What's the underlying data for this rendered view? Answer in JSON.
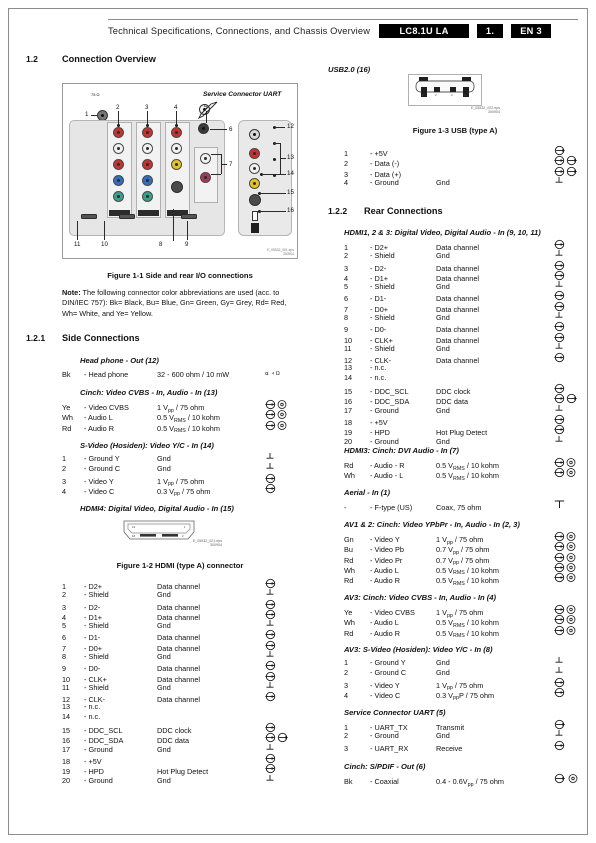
{
  "header": {
    "title": "Technical Specifications, Connections, and Chassis Overview",
    "chassis": "LC8.1U LA",
    "section": "1.",
    "language": "EN 3"
  },
  "sections": {
    "connection_overview": {
      "num": "1.2",
      "title": "Connection Overview"
    },
    "side_connections": {
      "num": "1.2.1",
      "title": "Side Connections"
    },
    "rear_connections": {
      "num": "1.2.2",
      "title": "Rear Connections"
    }
  },
  "figures": {
    "fig_1_1": "Figure 1-1 Side and rear I/O connections",
    "fig_1_2": "Figure 1-2 HDMI (type A) connector",
    "fig_1_3": "Figure 1-3  USB (type A)",
    "usb_heading": "USB2.0 (16)",
    "service_connector_label": "Service Connector UART",
    "fig_source_1": "E_05532_022.eps",
    "fig_source_2": "300904",
    "fig1_source_1": "E_05532_001.eps",
    "fig1_source_2": "300904",
    "hdmi_source_1": "E_05532_021.eps",
    "hdmi_source_2": "300904"
  },
  "note": {
    "label": "Note:",
    "text": " The following connector color abbreviations are used (acc. to DIN/IEC 757): Bk= Black, Bu= Blue, Gn= Green, Gy= Grey, Rd= Red, Wh= White, and Ye= Yellow."
  },
  "callouts": {
    "numbers": [
      "1",
      "2",
      "3",
      "4",
      "5",
      "6",
      "7",
      "8",
      "9",
      "10",
      "11",
      "12",
      "13",
      "14",
      "15",
      "16"
    ]
  },
  "groups": {
    "headphone": {
      "title": "Head phone - Out (12)",
      "rows": [
        {
          "pin": "Bk",
          "name": "- Head phone",
          "desc": "32 - 600 ohm / 10 mW",
          "sym": "headphone-ohm"
        }
      ]
    },
    "cinch_cvbs_side": {
      "title": "Cinch: Video CVBS - In, Audio - In (13)",
      "rows": [
        {
          "pin": "Ye",
          "name": "- Video CVBS",
          "desc": "1 V<sub>pp</sub> / 75 ohm",
          "sym": "in-cinch"
        },
        {
          "pin": "Wh",
          "name": "- Audio L",
          "desc": "0.5 V<sub>RMS</sub> / 10 kohm",
          "sym": "in-cinch"
        },
        {
          "pin": "Rd",
          "name": "- Audio R",
          "desc": "0.5 V<sub>RMS</sub> / 10 kohm",
          "sym": "in-cinch"
        }
      ]
    },
    "svideo_side": {
      "title": "S-Video (Hosiden): Video Y/C - In (14)",
      "rows": [
        {
          "pin": "1",
          "name": "- Ground Y",
          "desc": "Gnd",
          "sym": "gnd"
        },
        {
          "pin": "2",
          "name": "- Ground C",
          "desc": "Gnd",
          "sym": "gnd"
        },
        {
          "pin": "3",
          "name": "- Video Y",
          "desc": "1 V<sub>pp</sub> / 75 ohm",
          "sym": "in"
        },
        {
          "pin": "4",
          "name": "- Video C",
          "desc": "0.3 V<sub>pp</sub> / 75 ohm",
          "sym": "in"
        }
      ]
    },
    "hdmi4": {
      "title": "HDMI4: Digital Video, Digital Audio - In (15)",
      "rows": [
        {
          "pin": "1",
          "name": "- D2+",
          "desc": "Data channel",
          "sym": "in"
        },
        {
          "pin": "2",
          "name": "- Shield",
          "desc": "Gnd",
          "sym": "gnd"
        },
        {
          "pin": "3",
          "name": "- D2-",
          "desc": "Data channel",
          "sym": "in"
        },
        {
          "pin": "4",
          "name": "- D1+",
          "desc": "Data channel",
          "sym": "in"
        },
        {
          "pin": "5",
          "name": "- Shield",
          "desc": "Gnd",
          "sym": "gnd"
        },
        {
          "pin": "6",
          "name": "- D1-",
          "desc": "Data channel",
          "sym": "in"
        },
        {
          "pin": "7",
          "name": "- D0+",
          "desc": "Data channel",
          "sym": "in"
        },
        {
          "pin": "8",
          "name": "- Shield",
          "desc": "Gnd",
          "sym": "gnd"
        },
        {
          "pin": "9",
          "name": "- D0-",
          "desc": "Data channel",
          "sym": "in"
        },
        {
          "pin": "10",
          "name": "- CLK+",
          "desc": "Data channel",
          "sym": "in"
        },
        {
          "pin": "11",
          "name": "- Shield",
          "desc": "Gnd",
          "sym": "gnd"
        },
        {
          "pin": "12",
          "name": "- CLK-",
          "desc": "Data channel",
          "sym": "in"
        },
        {
          "pin": "13",
          "name": "- n.c.",
          "desc": "",
          "sym": ""
        },
        {
          "pin": "14",
          "name": "- n.c.",
          "desc": "",
          "sym": ""
        },
        {
          "pin": "15",
          "name": "- DDC_SCL",
          "desc": "DDC clock",
          "sym": "in"
        },
        {
          "pin": "16",
          "name": "- DDC_SDA",
          "desc": "DDC data",
          "sym": "inout"
        },
        {
          "pin": "17",
          "name": "- Ground",
          "desc": "Gnd",
          "sym": "gnd"
        },
        {
          "pin": "18",
          "name": "- +5V",
          "desc": "",
          "sym": "in"
        },
        {
          "pin": "19",
          "name": "- HPD",
          "desc": "Hot Plug Detect",
          "sym": "in"
        },
        {
          "pin": "20",
          "name": "- Ground",
          "desc": "Gnd",
          "sym": "gnd"
        }
      ]
    },
    "usb": {
      "rows": [
        {
          "pin": "1",
          "name": "- +5V",
          "desc": "",
          "sym": "out"
        },
        {
          "pin": "2",
          "name": "- Data (-)",
          "desc": "",
          "sym": "inout"
        },
        {
          "pin": "3",
          "name": "- Data (+)",
          "desc": "",
          "sym": "inout"
        },
        {
          "pin": "4",
          "name": "- Ground",
          "desc": "Gnd",
          "sym": "gnd"
        }
      ]
    },
    "hdmi123": {
      "title": "HDMI1, 2 & 3: Digital Video, Digital Audio - In (9, 10, 11)",
      "rows": [
        {
          "pin": "1",
          "name": "- D2+",
          "desc": "Data channel",
          "sym": "in"
        },
        {
          "pin": "2",
          "name": "- Shield",
          "desc": "Gnd",
          "sym": "gnd"
        },
        {
          "pin": "3",
          "name": "- D2-",
          "desc": "Data channel",
          "sym": "in"
        },
        {
          "pin": "4",
          "name": "- D1+",
          "desc": "Data channel",
          "sym": "in"
        },
        {
          "pin": "5",
          "name": "- Shield",
          "desc": "Gnd",
          "sym": "gnd"
        },
        {
          "pin": "6",
          "name": "- D1-",
          "desc": "Data channel",
          "sym": "in"
        },
        {
          "pin": "7",
          "name": "- D0+",
          "desc": "Data channel",
          "sym": "in"
        },
        {
          "pin": "8",
          "name": "- Shield",
          "desc": "Gnd",
          "sym": "gnd"
        },
        {
          "pin": "9",
          "name": "- D0-",
          "desc": "Data channel",
          "sym": "in"
        },
        {
          "pin": "10",
          "name": "- CLK+",
          "desc": "Data channel",
          "sym": "in"
        },
        {
          "pin": "11",
          "name": "- Shield",
          "desc": "Gnd",
          "sym": "gnd"
        },
        {
          "pin": "12",
          "name": "- CLK-",
          "desc": "Data channel",
          "sym": "in"
        },
        {
          "pin": "13",
          "name": "- n.c.",
          "desc": "",
          "sym": ""
        },
        {
          "pin": "14",
          "name": "- n.c.",
          "desc": "",
          "sym": ""
        },
        {
          "pin": "15",
          "name": "- DDC_SCL",
          "desc": "DDC clock",
          "sym": "in"
        },
        {
          "pin": "16",
          "name": "- DDC_SDA",
          "desc": "DDC data",
          "sym": "inout"
        },
        {
          "pin": "17",
          "name": "- Ground",
          "desc": "Gnd",
          "sym": "gnd"
        },
        {
          "pin": "18",
          "name": "- +5V",
          "desc": "",
          "sym": "in"
        },
        {
          "pin": "19",
          "name": "- HPD",
          "desc": "Hot Plug Detect",
          "sym": "in"
        },
        {
          "pin": "20",
          "name": "- Ground",
          "desc": "Gnd",
          "sym": "gnd"
        }
      ]
    },
    "hdmi3_cinch": {
      "title": "HDMI3: Cinch: DVI Audio - In (7)",
      "rows": [
        {
          "pin": "Rd",
          "name": "- Audio - R",
          "desc": "0.5 V<sub>RMS</sub> / 10 kohm",
          "sym": "in-cinch"
        },
        {
          "pin": "Wh",
          "name": "- Audio - L",
          "desc": "0.5 V<sub>RMS</sub> / 10 kohm",
          "sym": "in-cinch"
        }
      ]
    },
    "aerial": {
      "title": "Aerial - In (1)",
      "rows": [
        {
          "pin": "-",
          "name": "- F-type (US)",
          "desc": "Coax, 75 ohm",
          "sym": "aerial"
        }
      ]
    },
    "av12": {
      "title": "AV1 & 2: Cinch: Video YPbPr - In, Audio - In (2, 3)",
      "rows": [
        {
          "pin": "Gn",
          "name": "- Video Y",
          "desc": "1 V<sub>pp</sub> / 75 ohm",
          "sym": "in-cinch"
        },
        {
          "pin": "Bu",
          "name": "- Video Pb",
          "desc": "0.7 V<sub>pp</sub> / 75 ohm",
          "sym": "in-cinch"
        },
        {
          "pin": "Rd",
          "name": "- Video Pr",
          "desc": "0.7 V<sub>pp</sub> / 75 ohm",
          "sym": "in-cinch"
        },
        {
          "pin": "Wh",
          "name": "- Audio L",
          "desc": "0.5 V<sub>RMS</sub> / 10 kohm",
          "sym": "in-cinch"
        },
        {
          "pin": "Rd",
          "name": "- Audio R",
          "desc": "0.5 V<sub>RMS</sub> / 10 kohm",
          "sym": "in-cinch"
        }
      ]
    },
    "av3_cinch": {
      "title": "AV3: Cinch: Video CVBS - In, Audio - In (4)",
      "rows": [
        {
          "pin": "Ye",
          "name": "- Video CVBS",
          "desc": "1 V<sub>pp</sub> / 75 ohm",
          "sym": "in-cinch"
        },
        {
          "pin": "Wh",
          "name": "- Audio L",
          "desc": "0.5 V<sub>RMS</sub> / 10 kohm",
          "sym": "in-cinch"
        },
        {
          "pin": "Rd",
          "name": "- Audio R",
          "desc": "0.5 V<sub>RMS</sub> / 10 kohm",
          "sym": "in-cinch"
        }
      ]
    },
    "av3_svideo": {
      "title": "AV3: S-Video (Hosiden): Video Y/C - In (8)",
      "rows": [
        {
          "pin": "1",
          "name": "- Ground Y",
          "desc": "Gnd",
          "sym": "gnd"
        },
        {
          "pin": "2",
          "name": "- Ground C",
          "desc": "Gnd",
          "sym": "gnd"
        },
        {
          "pin": "3",
          "name": "- Video Y",
          "desc": "1 V<sub>pp</sub> / 75 ohm",
          "sym": "in"
        },
        {
          "pin": "4",
          "name": "- Video C",
          "desc": "0.3 V<sub>pp</sub>P / 75 ohm",
          "sym": "in"
        }
      ]
    },
    "service_uart": {
      "title": "Service Connector UART (5)",
      "rows": [
        {
          "pin": "1",
          "name": "- UART_TX",
          "desc": "Transmit",
          "sym": "out"
        },
        {
          "pin": "2",
          "name": "- Ground",
          "desc": "Gnd",
          "sym": "gnd"
        },
        {
          "pin": "3",
          "name": "- UART_RX",
          "desc": "Receive",
          "sym": "in"
        }
      ]
    },
    "spdif": {
      "title": "Cinch: S/PDIF - Out (6)",
      "rows": [
        {
          "pin": "Bk",
          "name": "- Coaxial",
          "desc": "0.4 - 0.6V<sub>pp</sub> / 75 ohm",
          "sym": "out-cinch"
        }
      ]
    }
  }
}
